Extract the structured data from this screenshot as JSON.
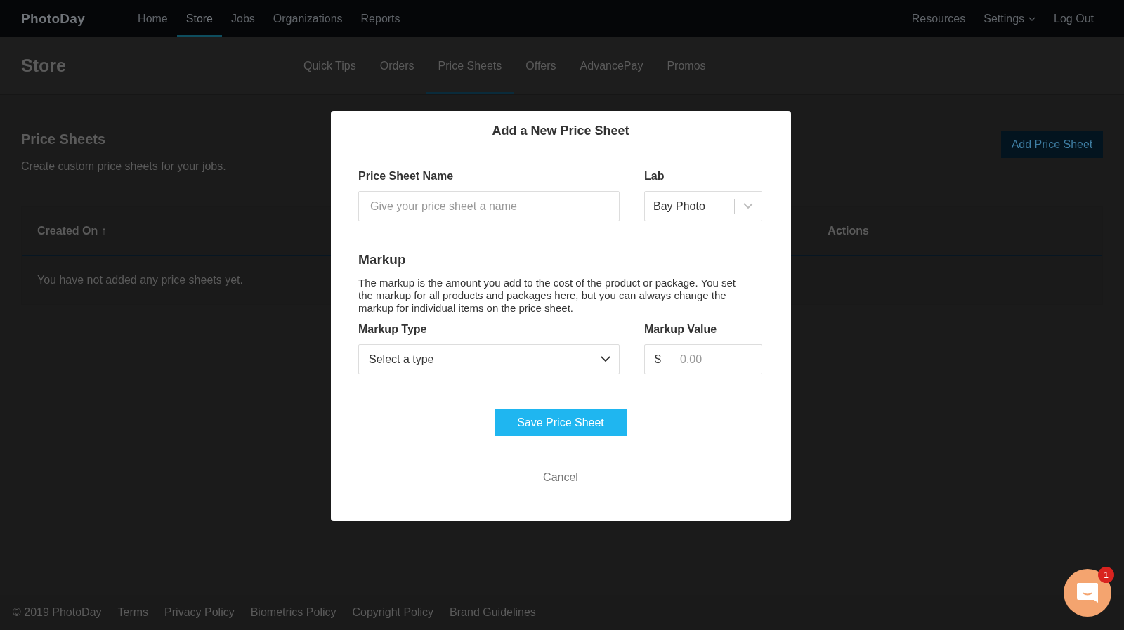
{
  "topnav": {
    "logo": "PhotoDay",
    "items": [
      {
        "label": "Home",
        "selected": false
      },
      {
        "label": "Store",
        "selected": true
      },
      {
        "label": "Jobs",
        "selected": false
      },
      {
        "label": "Organizations",
        "selected": false
      },
      {
        "label": "Reports",
        "selected": false
      }
    ],
    "right_items": [
      {
        "label": "Resources",
        "kind": "link"
      },
      {
        "label": "Settings",
        "kind": "menu"
      },
      {
        "label": "Log Out",
        "kind": "link"
      }
    ]
  },
  "subnav": {
    "title": "Store",
    "tabs": [
      {
        "label": "Quick Tips",
        "selected": false
      },
      {
        "label": "Orders",
        "selected": false
      },
      {
        "label": "Price Sheets",
        "selected": true
      },
      {
        "label": "Offers",
        "selected": false
      },
      {
        "label": "AdvancePay",
        "selected": false
      },
      {
        "label": "Promos",
        "selected": false
      }
    ]
  },
  "content": {
    "title": "Price Sheets",
    "description": "Create custom price sheets for your jobs.",
    "add_button": "Add Price Sheet",
    "table": {
      "columns": [
        "Created On ↑",
        "Actions"
      ],
      "empty_message": "You have not added any price sheets yet."
    }
  },
  "modal": {
    "title": "Add a New Price Sheet",
    "name_label": "Price Sheet Name",
    "name_placeholder": "Give your price sheet a name",
    "lab_label": "Lab",
    "lab_value": "Bay Photo",
    "markup_heading": "Markup",
    "markup_text": "The markup is the amount you add to the cost of the product or package. You set the markup for all products and packages here, but you can always change the markup for individual items on the price sheet.",
    "markup_type_label": "Markup Type",
    "markup_type_value": "Select a type",
    "markup_value_label": "Markup Value",
    "currency": "$",
    "markup_value_placeholder": "0.00",
    "save_button": "Save Price Sheet",
    "cancel": "Cancel"
  },
  "footer": {
    "links": [
      "© 2019 PhotoDay",
      "Terms",
      "Privacy Policy",
      "Biometrics Policy",
      "Copyright Policy",
      "Brand Guidelines"
    ]
  },
  "chat": {
    "badge": "1"
  }
}
